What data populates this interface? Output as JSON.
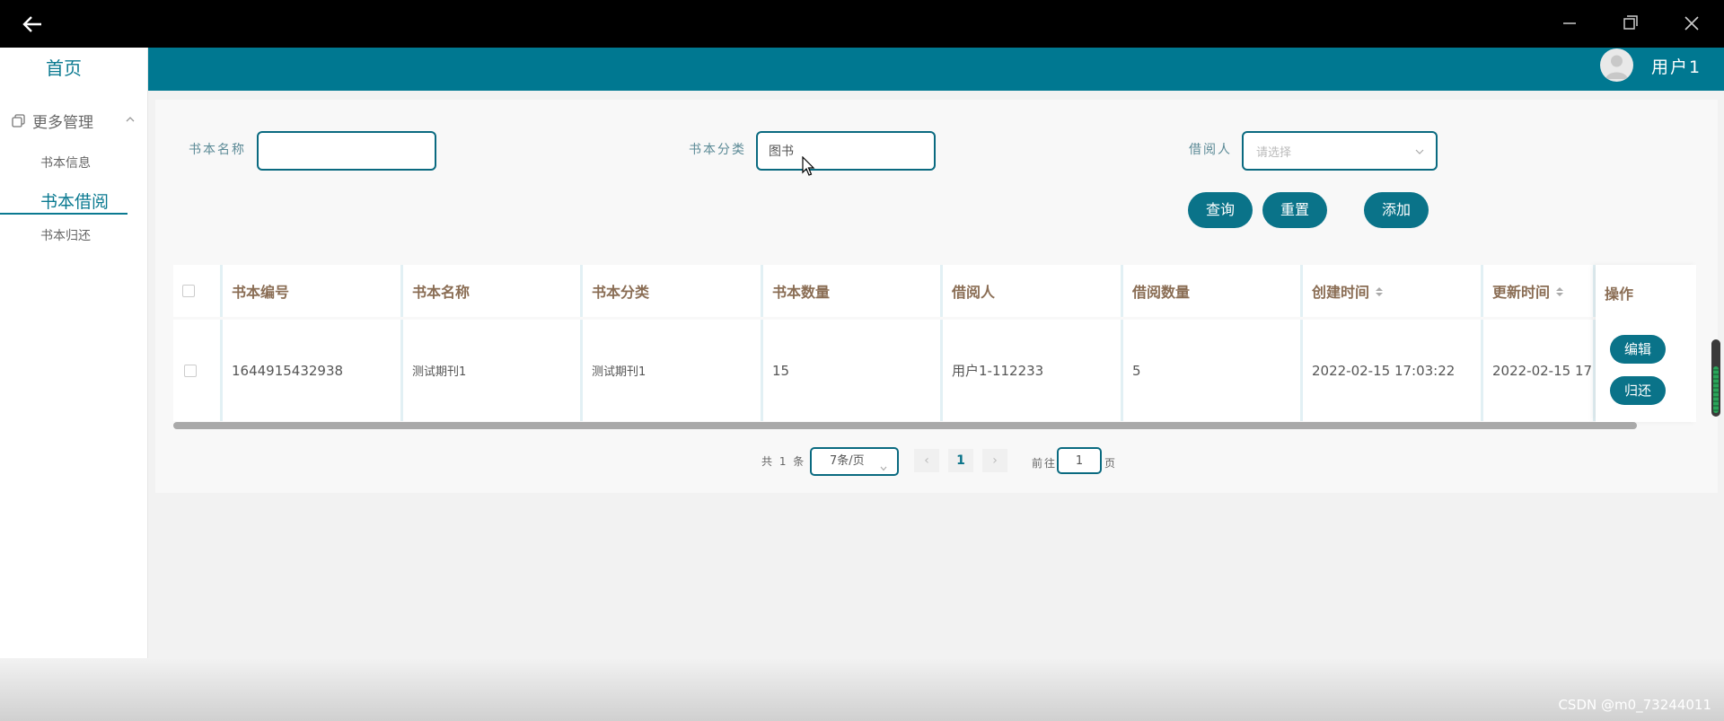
{
  "window": {
    "back_icon": "arrow-left-icon",
    "controls": [
      "minimize-icon",
      "restore-icon",
      "close-icon"
    ]
  },
  "sidebar": {
    "home": "首页",
    "group": {
      "label": "更多管理",
      "icon": "copy-icon",
      "arrow": "chevron-up-icon"
    },
    "items": [
      {
        "label": "书本信息",
        "active": false
      },
      {
        "label": "书本借阅",
        "active": true
      },
      {
        "label": "书本归还",
        "active": false
      }
    ]
  },
  "header": {
    "username": "用户1",
    "avatar_icon": "user-avatar-icon",
    "band_color": "#007891"
  },
  "filters": {
    "book_name": {
      "label": "书本名称",
      "value": ""
    },
    "book_category": {
      "label": "书本分类",
      "value": "图书"
    },
    "borrower": {
      "label": "借阅人",
      "placeholder": "请选择"
    }
  },
  "actions": {
    "search": "查询",
    "reset": "重置",
    "add": "添加"
  },
  "table": {
    "columns": [
      "书本编号",
      "书本名称",
      "书本分类",
      "书本数量",
      "借阅人",
      "借阅数量",
      "创建时间",
      "更新时间",
      "操作"
    ],
    "rows": [
      {
        "book_id": "1644915432938",
        "book_name": "测试期刊1",
        "category": "测试期刊1",
        "quantity": "15",
        "borrower": "用户1-112233",
        "borrow_count": "5",
        "created": "2022-02-15 17:03:22",
        "updated": "2022-02-15 17:"
      }
    ],
    "row_actions": {
      "edit": "编辑",
      "return": "归还"
    }
  },
  "pagination": {
    "total": "共 1 条",
    "page_size": "7条/页",
    "current_page": "1",
    "goto_label": "前往",
    "goto_value": "1",
    "page_suffix": "页"
  },
  "watermark": "CSDN @m0_73244011",
  "colors": {
    "accent": "#0a7389",
    "header_text": "#8a6d54"
  }
}
